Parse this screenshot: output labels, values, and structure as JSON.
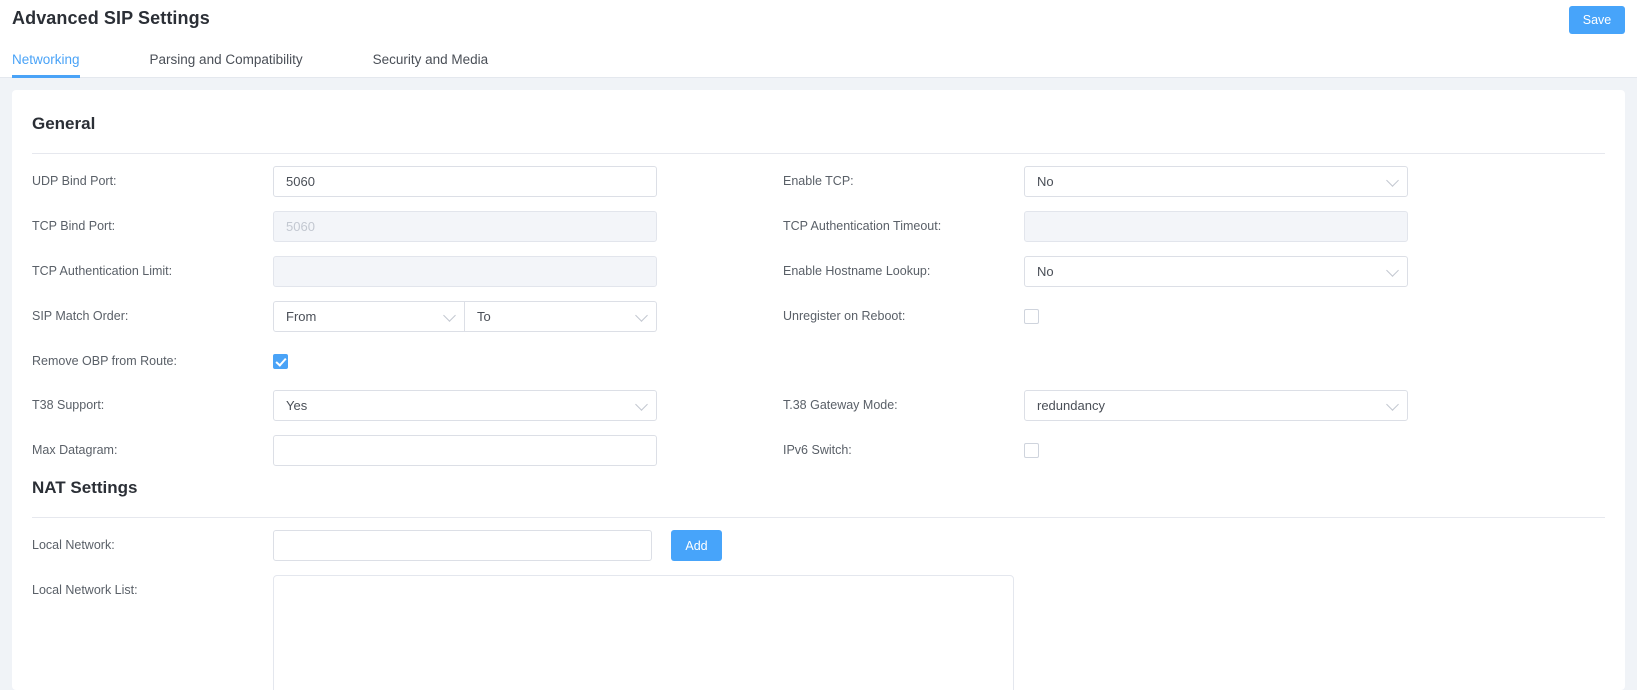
{
  "header": {
    "title": "Advanced SIP Settings",
    "save_label": "Save",
    "tabs": [
      {
        "label": "Networking",
        "active": true
      },
      {
        "label": "Parsing and Compatibility",
        "active": false
      },
      {
        "label": "Security and Media",
        "active": false
      }
    ]
  },
  "colors": {
    "accent": "#4aa3f7",
    "button": "#47a4fa",
    "page_bg": "#f0f3f7",
    "card_bg": "#ffffff",
    "label": "#5a6068",
    "value": "#4a4f57",
    "disabled_bg": "#f3f5f9",
    "disabled_text": "#c3c8d1"
  },
  "sections": {
    "general": {
      "title": "General",
      "fields": {
        "udp_bind_port": {
          "label": "UDP Bind Port:",
          "value": "5060"
        },
        "enable_tcp": {
          "label": "Enable TCP:",
          "value": "No"
        },
        "tcp_bind_port": {
          "label": "TCP Bind Port:",
          "value": "5060"
        },
        "tcp_auth_timeout": {
          "label": "TCP Authentication Timeout:",
          "value": ""
        },
        "tcp_auth_limit": {
          "label": "TCP Authentication Limit:",
          "value": ""
        },
        "enable_hostname_lookup": {
          "label": "Enable Hostname Lookup:",
          "value": "No"
        },
        "sip_match_order": {
          "label": "SIP Match Order:",
          "value_first": "From",
          "value_second": "To"
        },
        "unregister_on_reboot": {
          "label": "Unregister on Reboot:",
          "checked": false
        },
        "remove_obp_from_route": {
          "label": "Remove OBP from Route:",
          "checked": true
        },
        "t38_support": {
          "label": "T38 Support:",
          "value": "Yes"
        },
        "t38_gateway_mode": {
          "label": "T.38 Gateway Mode:",
          "value": "redundancy"
        },
        "max_datagram": {
          "label": "Max Datagram:",
          "value": ""
        },
        "ipv6_switch": {
          "label": "IPv6 Switch:",
          "checked": false
        }
      }
    },
    "nat": {
      "title": "NAT Settings",
      "fields": {
        "local_network": {
          "label": "Local Network:",
          "value": ""
        },
        "add_label": "Add",
        "local_network_list": {
          "label": "Local Network List:",
          "value": ""
        }
      }
    }
  }
}
